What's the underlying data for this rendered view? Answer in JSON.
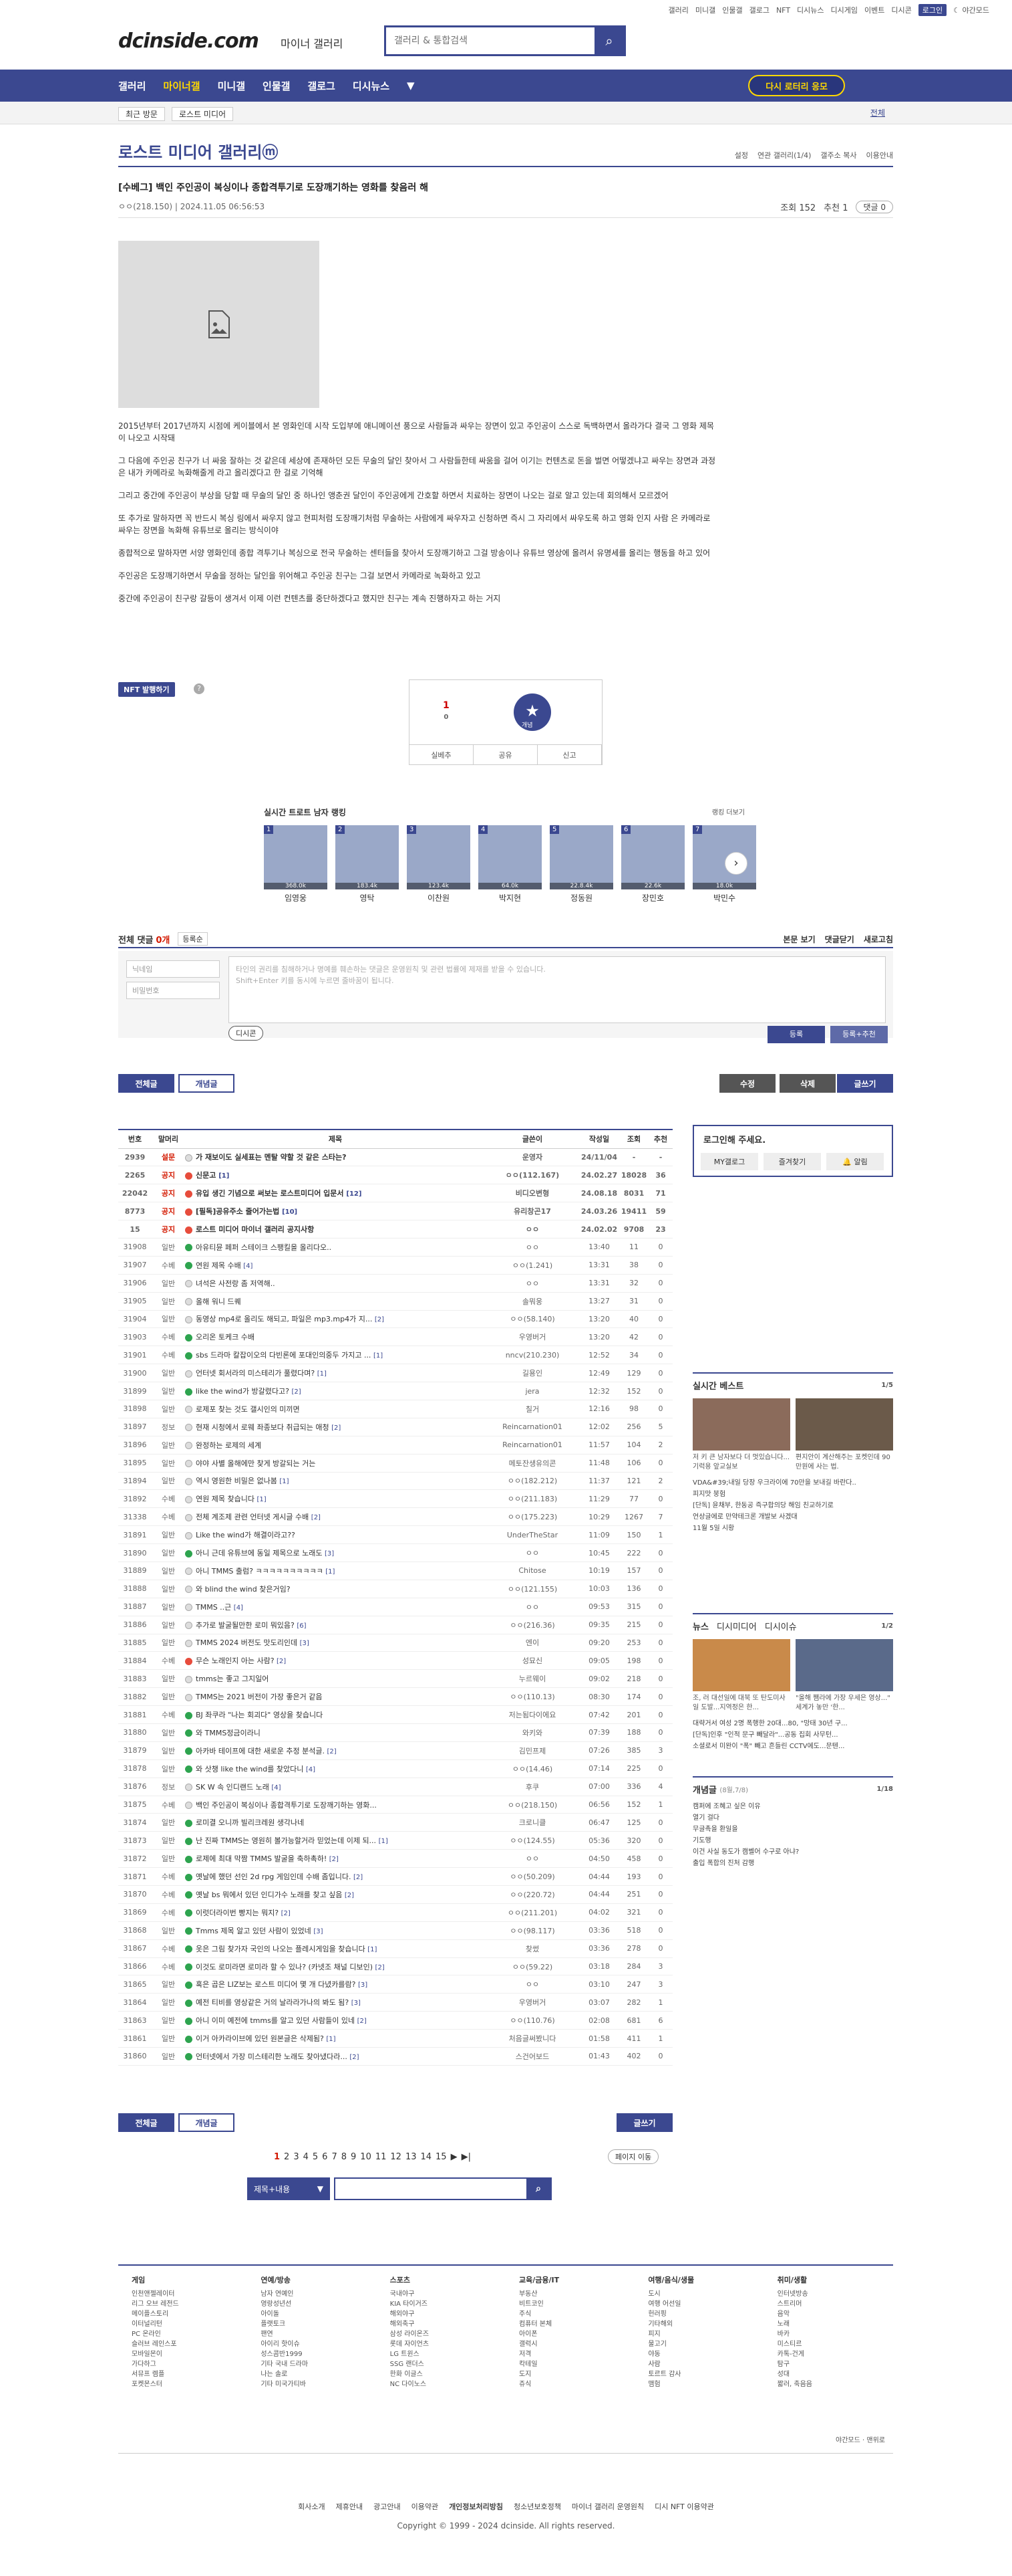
{
  "top_util": [
    "갤러리",
    "미니갤",
    "인물갤",
    "갤로그",
    "NFT",
    "디시뉴스",
    "디시게임",
    "이벤트",
    "디시콘",
    "로그인",
    "야간모드"
  ],
  "header": {
    "logo": "dcinside.com",
    "logo_sub": "마이너 갤러리",
    "search_placeholder": "갤러리 & 통합검색"
  },
  "gnb": {
    "items": [
      "갤러리",
      "마이너갤",
      "미니갤",
      "인물갤",
      "갤로그",
      "디시뉴스"
    ],
    "revisit": "다시 로터리 응모"
  },
  "crumb": {
    "items": [
      "최근 방문",
      "로스트 미디어"
    ],
    "right": "전체"
  },
  "gallery": {
    "title": "로스트 미디어 갤러리ⓜ",
    "options": [
      "설정",
      "연관 갤러리(1/4)",
      "갤주소 복사",
      "이용안내"
    ]
  },
  "post": {
    "title": "[수베그] 백인 주인공이 복싱이나 종합격투기로 도장깨기하는 영화를 찾음러 해",
    "author": "ㅇㅇ(218.150)",
    "date": "2024.11.05 06:56:53",
    "views": "조회 152",
    "reco": "추천 1",
    "comments": "댓글 0",
    "paragraphs": [
      "2015년부터 2017년까지 시점에 케이블에서 본 영화인데 시작 도입부에 애니메이션 풍으로 사람들과 싸우는 장면이 있고 주인공이 스스로 독백하면서 올라가다 결국 그 영화 제목이 나오고 시작돼",
      "그 다음에 주인공 친구가 너 싸움 잘하는 것 같은데 세상에 존재하던 모든 무술의 달인 찾아서 그 사람들한테 싸움을 걸어 이기는 컨텐츠로 돈을 벌면 어떻겠냐고 싸우는 장면과 과정은 내가 카메라로 녹화해줄게 라고 올리겠다고 한 걸로 기억해",
      "그리고 중간에 주인공이 부상을 당할 때 무술의 달인 중 하나인 앵춘권 달인이 주인공에게 간호할 하면서 치료하는 장면이 나오는 걸로 알고 있는데 회의해서 모르겠어",
      "또 추가로 말하자면 꼭 반드시 복싱 링에서 싸우지 않고 현피처럼 도장깨기처럼 무술하는 사람에게 싸우자고 신청하면 즉시 그 자리에서 싸우도록 하고 영화 인지 사람 은 카메라로 싸우는 장면을 녹화해 유튜브로 올리는 방식이야",
      "종합적으로 말하자면 서양 영화인데 종합 격투기나 복싱으로 전국 무술하는 센터들을 찾아서 도장깨기하고 그걸 방송이나 유튜브 영상에 올려서 유명세를 올리는 행동을 하고 있어",
      "주인공은 도장깨기하면서 무술을 정하는 달인을 위어해고 주인공 친구는 그걸 보면서 카메라로 녹화하고 있고",
      "중간에 주인공이 친구랑 갈등이 생겨서 이제 이런 컨텐츠를 중단하겠다고 했지만 친구는 계속 진행하자고 하는 거지"
    ]
  },
  "nft": {
    "label": "NFT 발행하기"
  },
  "reco_box": {
    "count": "1",
    "sub": "0",
    "star": "개념",
    "bar": [
      "실베추",
      "공유",
      "신고"
    ]
  },
  "ranking": {
    "title": "실시간 트로트 남자 랭킹",
    "more": "랭킹 더보기",
    "people": [
      {
        "no": "1",
        "name": "임영웅",
        "votes": "368.0k"
      },
      {
        "no": "2",
        "name": "영탁",
        "votes": "183.4k"
      },
      {
        "no": "3",
        "name": "이찬원",
        "votes": "123.4k"
      },
      {
        "no": "4",
        "name": "박지현",
        "votes": "64.0k"
      },
      {
        "no": "5",
        "name": "정동원",
        "votes": "22.8.4k"
      },
      {
        "no": "6",
        "name": "장민호",
        "votes": "22.6k"
      },
      {
        "no": "7",
        "name": "박민수",
        "votes": "18.0k"
      }
    ]
  },
  "comments": {
    "label": "전체 댓글",
    "count": "0개",
    "sort": "등록순",
    "right": [
      "본문 보기",
      "댓글닫기",
      "새로고침"
    ],
    "name_ph": "닉네임",
    "pw_ph": "비밀번호",
    "ta_ph": "타인의 권리를 침해하거나 명예를 훼손하는 댓글은 운영원칙 및 관련 법률에 제재를 받을 수 있습니다.",
    "ta_ph2": "Shift+Enter 키를 동시에 누르면 줄바꿈이 됩니다.",
    "dc": "디시콘",
    "reg": "등록",
    "reg2": "등록+추천"
  },
  "buttons": {
    "all": "전체글",
    "concept": "개념글",
    "edit": "수정",
    "delete": "삭제",
    "write": "글쓰기"
  },
  "list": {
    "headers": [
      "번호",
      "말머리",
      "제목",
      "글쓴이",
      "작성일",
      "조회",
      "추천"
    ],
    "rows": [
      [
        "2939",
        "설문",
        "ic-t",
        "가 재보이도 실세표는 멘탈 약할 것 같은 스타는?",
        "",
        "운영자",
        "24/11/04",
        "-",
        "-",
        "notice"
      ],
      [
        "2265",
        "공지",
        "ic-n",
        "신문고",
        "[1]",
        "ㅇㅇ(112.167)",
        "24.02.27",
        "18028",
        "36",
        "notice"
      ],
      [
        "22042",
        "공지",
        "ic-n",
        "유입 생긴 기념으로 써보는 로스트미디어 입문서",
        "[12]",
        "비디오변형",
        "24.08.18",
        "8031",
        "71",
        "notice"
      ],
      [
        "8773",
        "공지",
        "ic-n",
        "[필독]공유주소 줄어가는법",
        "[10]",
        "유리창곤17",
        "24.03.26",
        "19411",
        "59",
        "notice"
      ],
      [
        "15",
        "공지",
        "ic-n",
        "로스트 미디어 마이너 갤러리 공지사항",
        "",
        "ㅇㅇ",
        "24.02.02",
        "9708",
        "23",
        "notice"
      ],
      [
        "31908",
        "일반",
        "ic-p",
        "아유티뮨 페퍼 스테이크 스팽킬을 올리다오..",
        "",
        "ㅇㅇ",
        "13:40",
        "11",
        "0",
        ""
      ],
      [
        "31907",
        "수베",
        "ic-p",
        "연원 제목 수배",
        "[4]",
        "ㅇㅇ(1.241)",
        "13:31",
        "38",
        "0",
        ""
      ],
      [
        "31906",
        "일반",
        "ic-t",
        "녀석은 사전랑 좀 저역해..",
        "",
        "ㅇㅇ",
        "13:31",
        "32",
        "0",
        ""
      ],
      [
        "31905",
        "일반",
        "ic-t",
        "올해 워니 드퀘",
        "",
        "솔뭐웅",
        "13:27",
        "31",
        "0",
        ""
      ],
      [
        "31904",
        "일반",
        "ic-t",
        "동영상 mp4로 올리도 해되고, 파일은 mp3.mp4가 지...",
        "[2]",
        "ㅇㅇ(58.140)",
        "13:20",
        "40",
        "0",
        ""
      ],
      [
        "31903",
        "수베",
        "ic-p",
        "오리온 토케크 수배",
        "",
        "우영버거",
        "13:20",
        "42",
        "0",
        ""
      ],
      [
        "31901",
        "수베",
        "ic-p",
        "sbs 드라마 칼잡이오의 다빈론에 포대인의중두 가지고 ...",
        "[1]",
        "nncv(210.230)",
        "12:52",
        "34",
        "0",
        ""
      ],
      [
        "31900",
        "일반",
        "ic-t",
        "언터넷 회서라의 미스테리가 풀렸다며?",
        "[1]",
        "길용인",
        "12:49",
        "129",
        "0",
        ""
      ],
      [
        "31899",
        "일반",
        "ic-p",
        "like the wind가 방갈렸다고?",
        "[2]",
        "jera",
        "12:32",
        "152",
        "0",
        ""
      ],
      [
        "31898",
        "일반",
        "ic-t",
        "로제포 찾는 것도 갤시인의 미끼면",
        "",
        "칠거",
        "12:16",
        "98",
        "0",
        ""
      ],
      [
        "31897",
        "정보",
        "ic-t",
        "현재 시청에서 로웨 좌종보다 취급되는 애청",
        "[2]",
        "Reincarnation01",
        "12:02",
        "256",
        "5",
        ""
      ],
      [
        "31896",
        "일반",
        "ic-t",
        "완정하는 로제의 세계",
        "",
        "Reincarnation01",
        "11:57",
        "104",
        "2",
        ""
      ],
      [
        "31895",
        "일반",
        "ic-t",
        "야야 사별 올해에만 찾게 방갈되는 거는",
        "",
        "메토잔생유의콘",
        "11:48",
        "106",
        "0",
        ""
      ],
      [
        "31894",
        "일반",
        "ic-t",
        "역시 영원한 비밀은 없나봄",
        "[1]",
        "ㅇㅇ(182.212)",
        "11:37",
        "121",
        "2",
        ""
      ],
      [
        "31892",
        "수베",
        "ic-t",
        "연원 제목 찾습니다",
        "[1]",
        "ㅇㅇ(211.183)",
        "11:29",
        "77",
        "0",
        ""
      ],
      [
        "31338",
        "수베",
        "ic-t",
        "전체 계조제 관련 언터넷 게시글 수배",
        "[2]",
        "ㅇㅇ(175.223)",
        "10:29",
        "1267",
        "7",
        ""
      ],
      [
        "31891",
        "일반",
        "ic-t",
        "Like the wind가 해결이라고??",
        "",
        "UnderTheStar",
        "11:09",
        "150",
        "1",
        ""
      ],
      [
        "31890",
        "일반",
        "ic-p",
        "아니 근데 유튜브에 동일 제목으로 노래도",
        "[3]",
        "ㅇㅇ",
        "10:45",
        "222",
        "0",
        ""
      ],
      [
        "31889",
        "일반",
        "ic-t",
        "아니 TMMS 출럼? ㅋㅋㅋㅋㅋㅋㅋㅋㅋㅋ",
        "[1]",
        "Chitose",
        "10:19",
        "157",
        "0",
        ""
      ],
      [
        "31888",
        "일반",
        "ic-t",
        "와 blind the wind 찾은거임?",
        "",
        "ㅇㅇ(121.155)",
        "10:03",
        "136",
        "0",
        ""
      ],
      [
        "31887",
        "일반",
        "ic-t",
        "TMMS ..근",
        "[4]",
        "ㅇㅇ",
        "09:53",
        "315",
        "0",
        ""
      ],
      [
        "31886",
        "일반",
        "ic-t",
        "추가로 발굴될만한 로미 뭐있음?",
        "[6]",
        "ㅇㅇ(216.36)",
        "09:35",
        "215",
        "0",
        ""
      ],
      [
        "31885",
        "일반",
        "ic-t",
        "TMMS 2024 버전도 맛도리인데",
        "[3]",
        "엔이",
        "09:20",
        "253",
        "0",
        ""
      ],
      [
        "31884",
        "수베",
        "ic-n",
        "무슨 노래인지 아는 사람?",
        "[2]",
        "성묘신",
        "09:05",
        "198",
        "0",
        ""
      ],
      [
        "31883",
        "일반",
        "ic-t",
        "tmms는 좋고 그지일어",
        "",
        "누르웨이",
        "09:02",
        "218",
        "0",
        ""
      ],
      [
        "31882",
        "일반",
        "ic-t",
        "TMMS는 2021 버전이 가장 좋은거 같음",
        "",
        "ㅇㅇ(110.13)",
        "08:30",
        "174",
        "0",
        ""
      ],
      [
        "31881",
        "수베",
        "ic-p",
        "BJ 좌쿠라 \"나는 회괴다\" 영상을 찾습니다",
        "",
        "저는됨다이에요",
        "07:42",
        "201",
        "0",
        ""
      ],
      [
        "31880",
        "일반",
        "ic-p",
        "와 TMMS정금이라니",
        "",
        "와키와",
        "07:39",
        "188",
        "0",
        ""
      ],
      [
        "31879",
        "일반",
        "ic-p",
        "아카바 테이프에 대한 새로운 추정 분석글.",
        "[2]",
        "김민프제",
        "07:26",
        "385",
        "3",
        ""
      ],
      [
        "31878",
        "일반",
        "ic-p",
        "와 삿챙 like the wind를 찾았다니",
        "[4]",
        "ㅇㅇ(14.46)",
        "07:14",
        "225",
        "0",
        ""
      ],
      [
        "31876",
        "정보",
        "ic-t",
        "SK W 속 인디랜드 노래",
        "[4]",
        "후쿠",
        "07:00",
        "336",
        "4",
        ""
      ],
      [
        "31875",
        "수베",
        "ic-t",
        "백인 주인공이 복싱이나 종합격투기로 도장깨기하는 영화...",
        "",
        "ㅇㅇ(218.150)",
        "06:56",
        "152",
        "1",
        ""
      ],
      [
        "31874",
        "일반",
        "ic-p",
        "로미결 오니까 빌리크레원 생각나네",
        "",
        "크로니클",
        "06:47",
        "125",
        "0",
        ""
      ],
      [
        "31873",
        "일반",
        "ic-p",
        "난 진짜 TMMS는 영원히 볼가능할거라 믿었는데 이제 되...",
        "[1]",
        "ㅇㅇ(124.55)",
        "05:36",
        "320",
        "0",
        ""
      ],
      [
        "31872",
        "일반",
        "ic-p",
        "로제에 최대 막짬 TMMS 발굴을 축하촉하!",
        "[2]",
        "ㅇㅇ",
        "04:50",
        "458",
        "0",
        ""
      ],
      [
        "31871",
        "수베",
        "ic-p",
        "옛날에 했던 선인 2d rpg 게임인데 수배 좀입니다.",
        "[2]",
        "ㅇㅇ(50.209)",
        "04:44",
        "193",
        "0",
        ""
      ],
      [
        "31870",
        "수베",
        "ic-p",
        "옛날 bs 뭐에서 있던 인디가수 노래를 찾고 싶음",
        "[2]",
        "ㅇㅇ(220.72)",
        "04:44",
        "251",
        "0",
        ""
      ],
      [
        "31869",
        "수베",
        "ic-p",
        "이럿더라이번 빵지는 뭐지?",
        "[2]",
        "ㅇㅇ(211.201)",
        "04:02",
        "321",
        "0",
        ""
      ],
      [
        "31868",
        "일반",
        "ic-p",
        "Tmms 제목 알고 있던 사람이 있었네",
        "[3]",
        "ㅇㅇ(98.117)",
        "03:36",
        "518",
        "0",
        ""
      ],
      [
        "31867",
        "수베",
        "ic-p",
        "옷은 그림 찾가자 국인의 나오는 플레시게임을 찾습니다",
        "[1]",
        "찾썼",
        "03:36",
        "278",
        "0",
        ""
      ],
      [
        "31866",
        "수베",
        "ic-p",
        "이것도 로미라면 로미라 할 수 있나? (카넷조 채널 디보인)",
        "[2]",
        "ㅇㅇ(59.22)",
        "03:18",
        "284",
        "3",
        ""
      ],
      [
        "31865",
        "일반",
        "ic-p",
        "혹은 곱은 LIZ보는 로스트 미디어 몇 개 다녔카를람?",
        "[3]",
        "ㅇㅇ",
        "03:10",
        "247",
        "3",
        ""
      ],
      [
        "31864",
        "일반",
        "ic-p",
        "예전 티비를 영상같은 거의 날라라가나의 봐도 됨?",
        "[3]",
        "우영버거",
        "03:07",
        "282",
        "1",
        ""
      ],
      [
        "31863",
        "일반",
        "ic-p",
        "아니 이미 예전에 tmms를 알고 있던 사람들이 있네",
        "[2]",
        "ㅇㅇ(110.76)",
        "02:08",
        "681",
        "6",
        ""
      ],
      [
        "31861",
        "일반",
        "ic-p",
        "이거 아카라이브에 있던 원본글은 삭제됨?",
        "[1]",
        "처음글써봤니다",
        "01:58",
        "411",
        "1",
        ""
      ],
      [
        "31860",
        "일반",
        "ic-p",
        "언터넷에서 가장 미스테리한 노래도 찾아냈다라...",
        "[2]",
        "스건어보드",
        "01:43",
        "402",
        "0",
        ""
      ]
    ]
  },
  "side": {
    "login_title": "로그인해 주세요.",
    "login_btns": [
      "MY갤로그",
      "즐겨찾기",
      "알림"
    ],
    "best_title": "실시간 베스트",
    "best_page": "1/5",
    "best_caps": [
      "저 키 큰 남자보다 더 멋있습니다... 기럭용 앞교실보",
      "편지안이 계산해주는 포켓인데 90만원에 사는 법."
    ],
    "best_list": [
      "VDA&#39;내일 당장 우크라이에 70만을 보내길 바란다..",
      "피지맛 붕험",
      "[단독] 윤채부, 한동공 즉구합의당 해임 친교하기로",
      "언상글에로 만약테크론 개발보 사겠대",
      "11월 5일 시황"
    ],
    "news_title": [
      "뉴스",
      "디시미디어",
      "디시이슈"
    ],
    "news_page": "1/2",
    "news_caps": [
      "조, 러 대선일에 대북 또 탄도미사일 도발...지역정은 한...",
      "\"올해 쨈라에 가장 우세은 영상...\" 세계가 놓만 '한..."
    ],
    "news_list": [
      "대략거서 여성 2명 폭행한 20대...80, \"망태 30년 구...",
      "[단독]인후 \"인적 문구 빼달라\"...공동 집회 사무턴...",
      "소셜로서 미완이 \"폭\" 빼고 흔들린 CCTV에도...문텐..."
    ],
    "concept_title": "개념글",
    "concept_sub": "(8월,7/8)",
    "concept_page": "1/18",
    "concept_list": [
      "캠퍼에 조혜고 싶은 이유",
      "열기 걸다",
      "무글촉을 환일을",
      "기도행",
      "이건 사실 동도가 캠벨어 수구로 아냐?",
      "출입 폭합의 진처 감행"
    ]
  },
  "pager": {
    "pages": [
      "1",
      "2",
      "3",
      "4",
      "5",
      "6",
      "7",
      "8",
      "9",
      "10",
      "11",
      "12",
      "13",
      "14",
      "15"
    ],
    "jump": "페이지 이동",
    "search_sel": "제목+내용"
  },
  "footer": {
    "cols": [
      {
        "h": "게임",
        "items": [
          "인천앤젤레이터",
          "리그 오브 레전드",
          "메이플스토리",
          "이터널리턴",
          "PC 온라인",
          "슬러브 레인스포",
          "모바일몬이",
          "가다하그",
          "서뮤프 렘플",
          "포켓몬스터"
        ]
      },
      {
        "h": "연예/방송",
        "items": [
          "남자 연예인",
          "영랑성년선",
          "아이돌",
          "플랫토크",
          "팬연",
          "아이리 핫이슈",
          "성스콤반1999",
          "기타 국내 드라마",
          "나는 솔로",
          "기타 미국가티바"
        ]
      },
      {
        "h": "스포츠",
        "items": [
          "국내야구",
          "KIA 타이거즈",
          "해외야구",
          "해외축구",
          "삼성 라이온즈",
          "롯데 자이언츠",
          "LG 트윈스",
          "SSG 랜더스",
          "한화 이글스",
          "NC 다이노스"
        ]
      },
      {
        "h": "교육/금융/IT",
        "items": [
          "부동산",
          "비트코인",
          "주식",
          "컴퓨터 본체",
          "아이폰",
          "갤럭시",
          "저격",
          "칵테일",
          "도지",
          "쥬식"
        ]
      },
      {
        "h": "여행/음식/생물",
        "items": [
          "도시",
          "여행 어선일",
          "헌러핑",
          "기타해외",
          "피지",
          "물고기",
          "야동",
          "사람",
          "토르트 감사",
          "맴험"
        ]
      },
      {
        "h": "취미/생활",
        "items": [
          "인터넷방송",
          "스트리머",
          "음악",
          "노래",
          "바카",
          "미스티르",
          "카톡-건게",
          "탐구",
          "성대",
          "짧러, 축음음"
        ]
      }
    ],
    "right": [
      "야간모드",
      "맨위로"
    ],
    "menu": [
      "회사소개",
      "제휴안내",
      "광고안내",
      "이용약관",
      "개인정보처리방침",
      "청소년보호정책",
      "마이너 갤러리 운영원칙",
      "디시 NFT 이용약관"
    ],
    "copyright": "Copyright © 1999 - 2024 dcinside. All rights reserved."
  }
}
